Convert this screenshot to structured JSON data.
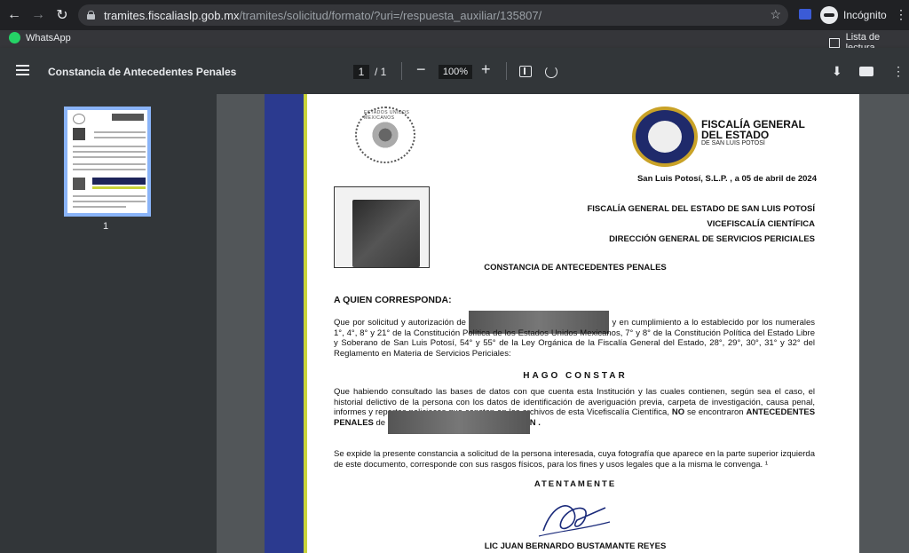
{
  "browser": {
    "url_host": "tramites.fiscaliaslp.gob.mx",
    "url_path": "/tramites/solicitud/formato/?uri=/respuesta_auxiliar/135807/",
    "profile_label": "Incógnito",
    "bookmarks": [
      {
        "label": "WhatsApp"
      }
    ],
    "reading_list_label": "Lista de lectura"
  },
  "pdf": {
    "title": "Constancia de Antecedentes Penales",
    "page_current": "1",
    "page_total": "/ 1",
    "zoom": "100%",
    "thumb_page_number": "1"
  },
  "document": {
    "seal_text": "ESTADOS UNIDOS MEXICANOS",
    "logo_title_line1": "FISCALÍA GENERAL",
    "logo_title_line2": "DEL ESTADO",
    "logo_subtitle": "DE SAN LUIS POTOSÍ",
    "date_line": "San Luis Potosí, S.L.P. , a  05 de abril de 2024",
    "dependencies": [
      "FISCALÍA GENERAL DEL ESTADO DE SAN LUIS POTOSÍ",
      "VICEFISCALÍA CIENTÍFICA",
      "DIRECCIÓN GENERAL DE SERVICIOS PERICIALES"
    ],
    "heading": "CONSTANCIA DE ANTECEDENTES PENALES",
    "salutation": "A QUIEN CORRESPONDA:",
    "para1_start": "Que por solicitud y autorización de",
    "para1_end": "y en cumplimiento a lo establecido por los numerales 1°, 4°, 8° y 21° de la Constitución Política de los Estados Unidos Mexicanos, 7° y 8° de la Constitución Política del Estado Libre y Soberano de San Luis Potosí, 54° y 55° de la Ley Orgánica de la Fiscalía General del Estado, 28°, 29°, 30°, 31° y 32° del Reglamento en Materia de Servicios Periciales:",
    "hago_constar": "HAGO CONSTAR",
    "para2_start": "Que habiendo consultado las bases de datos con que cuenta esta Institución y las cuales contienen, según sea el caso, el historial delictivo de la persona con los datos de identificación de averiguación previa, carpeta de investigación, causa penal, informes y reportes policiacos que constan en los archivos de esta Vicefiscalía Científica,",
    "para2_no": "NO",
    "para2_mid": "se encontraron",
    "para2_bold": "ANTECEDENTES PENALES",
    "para2_de": "de",
    "para2_end": "N .",
    "para3": "Se expide la presente constancia a solicitud de la persona interesada, cuya fotografía que aparece en la parte superior izquierda de este documento, corresponde con sus rasgos físicos, para los fines y usos legales que a la misma le convenga. ¹",
    "closing": "ATENTAMENTE",
    "signer": "LIC JUAN BERNARDO BUSTAMANTE REYES"
  }
}
